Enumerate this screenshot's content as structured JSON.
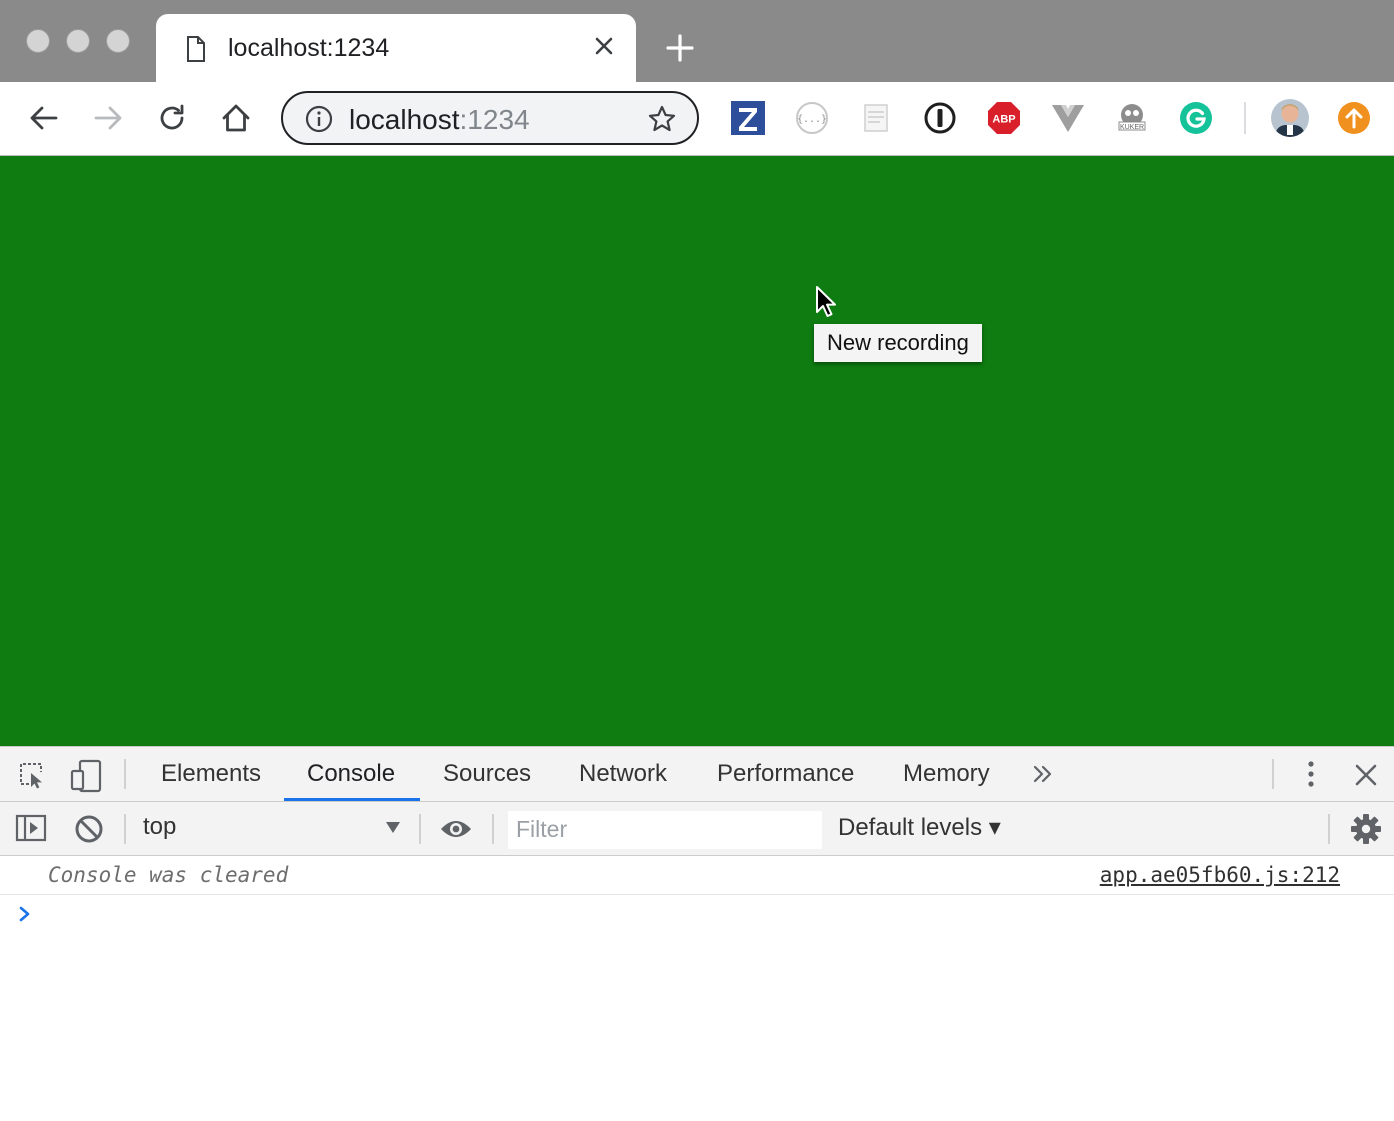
{
  "window": {
    "traffic_lights": [
      "close",
      "minimize",
      "zoom"
    ]
  },
  "tab": {
    "title": "localhost:1234",
    "icon": "document-icon"
  },
  "toolbar": {
    "url_host": "localhost",
    "url_port": ":1234",
    "extensions": [
      "zotero-z",
      "json-viewer",
      "page-ruler",
      "1password",
      "adblock-plus",
      "vue-devtools",
      "kuker",
      "grammarly",
      "profile-avatar",
      "update-available"
    ]
  },
  "page": {
    "background": "#0e7c11",
    "tooltip": "New recording"
  },
  "devtools": {
    "tabs": [
      "Elements",
      "Console",
      "Sources",
      "Network",
      "Performance",
      "Memory"
    ],
    "active_tab": "Console",
    "context": "top",
    "filter_placeholder": "Filter",
    "levels": "Default levels ▾",
    "messages": [
      {
        "text": "Console was cleared",
        "source": "app.ae05fb60.js:212"
      }
    ]
  }
}
